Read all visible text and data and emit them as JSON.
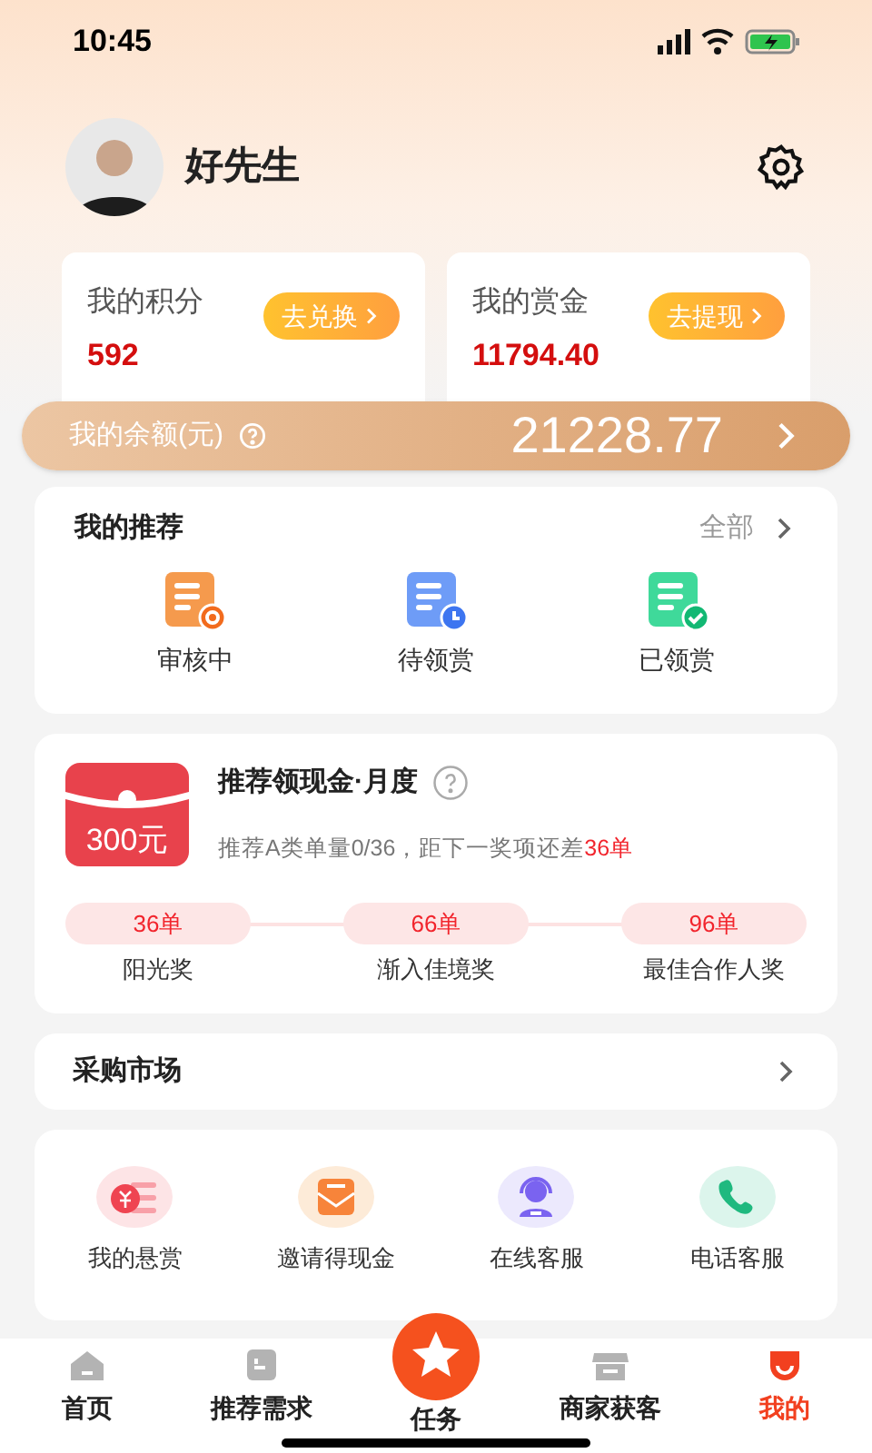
{
  "status_bar": {
    "time": "10:45"
  },
  "profile": {
    "name": "好先生"
  },
  "stats": [
    {
      "label": "我的积分",
      "value": "592",
      "button": "去兑换"
    },
    {
      "label": "我的赏金",
      "value": "11794.40",
      "button": "去提现"
    }
  ],
  "balance": {
    "label": "我的余额(元)",
    "amount": "21228.77"
  },
  "recommend": {
    "title": "我的推荐",
    "more": "全部",
    "items": [
      {
        "label": "审核中",
        "kind": "reviewing"
      },
      {
        "label": "待领赏",
        "kind": "pending"
      },
      {
        "label": "已领赏",
        "kind": "claimed"
      }
    ]
  },
  "cash": {
    "badge": "300元",
    "title": "推荐领现金·月度",
    "progress": "推荐A类单量0/36，距下一奖项还差",
    "remaining": "36单",
    "tiers": [
      {
        "count": "36单",
        "name": "阳光奖"
      },
      {
        "count": "66单",
        "name": "渐入佳境奖"
      },
      {
        "count": "96单",
        "name": "最佳合作人奖"
      }
    ]
  },
  "market": {
    "title": "采购市场"
  },
  "services": [
    {
      "label": "我的悬赏",
      "kind": "bounty"
    },
    {
      "label": "邀请得现金",
      "kind": "invite"
    },
    {
      "label": "在线客服",
      "kind": "support"
    },
    {
      "label": "电话客服",
      "kind": "phone"
    }
  ],
  "tabs": [
    {
      "label": "首页",
      "kind": "home",
      "selected": false
    },
    {
      "label": "推荐需求",
      "kind": "demand",
      "selected": false
    },
    {
      "label": "任务",
      "kind": "task",
      "selected": false
    },
    {
      "label": "商家获客",
      "kind": "shop",
      "selected": false
    },
    {
      "label": "我的",
      "kind": "mine",
      "selected": true
    }
  ]
}
